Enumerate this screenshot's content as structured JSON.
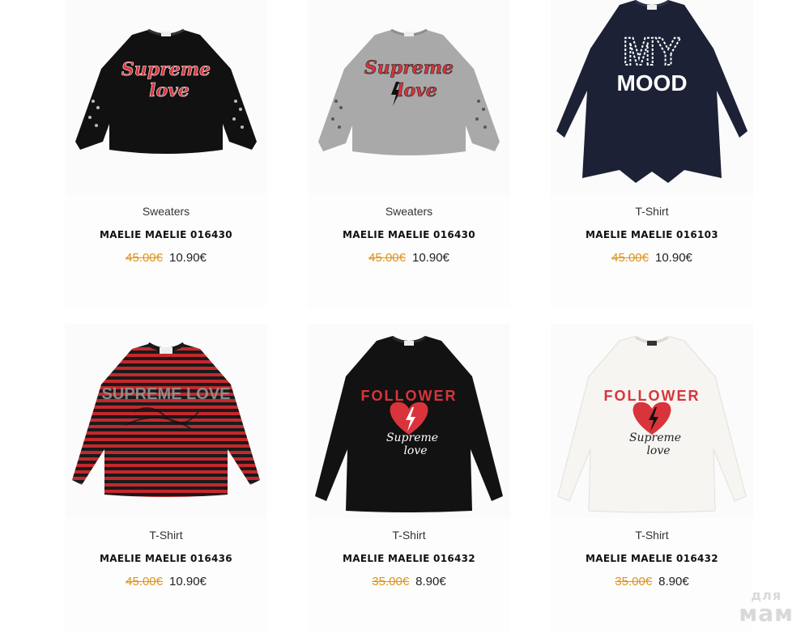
{
  "products": [
    {
      "category": "Sweaters",
      "name": "MAELIE MAELIE 016430",
      "old_price": "45.00€",
      "new_price": "10.90€",
      "image": {
        "garment": "cropped-sweater",
        "color": "#111111",
        "print": [
          "Supreme",
          "love"
        ],
        "print_color": "#d9343b"
      }
    },
    {
      "category": "Sweaters",
      "name": "MAELIE MAELIE 016430",
      "old_price": "45.00€",
      "new_price": "10.90€",
      "image": {
        "garment": "cropped-sweater",
        "color": "#a9a9a9",
        "print": [
          "Supreme",
          "love"
        ],
        "print_color": "#d9343b"
      }
    },
    {
      "category": "T-Shirt",
      "name": "MAELIE MAELIE 016103",
      "old_price": "45.00€",
      "new_price": "10.90€",
      "image": {
        "garment": "long-tunic",
        "color": "#1c2135",
        "print": [
          "MY",
          "MOOD"
        ],
        "print_color": "#ffffff"
      }
    },
    {
      "category": "T-Shirt",
      "name": "MAELIE MAELIE 016436",
      "old_price": "45.00€",
      "new_price": "10.90€",
      "image": {
        "garment": "striped-tee",
        "color": "#c3282d",
        "print": [
          "SUPREME LOVE"
        ],
        "print_color": "#9a9a9a"
      }
    },
    {
      "category": "T-Shirt",
      "name": "MAELIE MAELIE 016432",
      "old_price": "35.00€",
      "new_price": "8.90€",
      "image": {
        "garment": "long-tee",
        "color": "#121212",
        "print": [
          "FOLLOWER",
          "Supreme",
          "love"
        ],
        "print_color": "#d9343b"
      }
    },
    {
      "category": "T-Shirt",
      "name": "MAELIE MAELIE 016432",
      "old_price": "35.00€",
      "new_price": "8.90€",
      "image": {
        "garment": "long-tee",
        "color": "#f6f5f1",
        "print": [
          "FOLLOWER",
          "Supreme",
          "love"
        ],
        "print_color": "#d9343b"
      }
    }
  ],
  "watermark": {
    "line1": "для",
    "line2": "мам"
  }
}
